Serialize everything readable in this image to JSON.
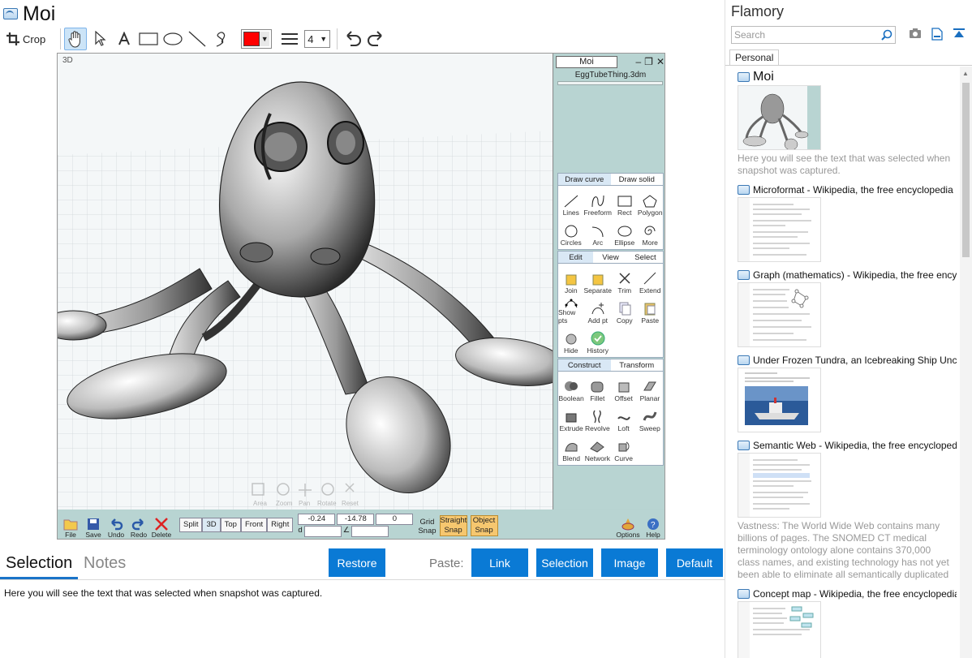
{
  "app": {
    "title": "Moi"
  },
  "toolbar": {
    "crop_label": "Crop",
    "line_width": "4",
    "color": "#ff0000"
  },
  "viewport": {
    "label": "3D",
    "nav_labels": [
      "Area",
      "Zoom",
      "Pan",
      "Rotate",
      "Reset"
    ]
  },
  "moi": {
    "panel_title": "Moi",
    "file_name": "EggTubeThing.3dm",
    "group1": {
      "tabs": [
        "Draw curve",
        "Draw solid"
      ],
      "items": [
        "Lines",
        "Freeform",
        "Rect",
        "Polygon",
        "Circles",
        "Arc",
        "Ellipse",
        "More"
      ]
    },
    "group2": {
      "tabs": [
        "Edit",
        "View",
        "Select"
      ],
      "items": [
        "Join",
        "Separate",
        "Trim",
        "Extend",
        "Show pts",
        "Add pt",
        "Copy",
        "Paste",
        "Hide",
        "History"
      ]
    },
    "group3": {
      "tabs": [
        "Construct",
        "Transform"
      ],
      "items": [
        "Boolean",
        "Fillet",
        "Offset",
        "Planar",
        "Extrude",
        "Revolve",
        "Loft",
        "Sweep",
        "Blend",
        "Network",
        "Curve"
      ]
    },
    "bottom": {
      "file": "File",
      "save": "Save",
      "undo": "Undo",
      "redo": "Redo",
      "delete": "Delete",
      "views": [
        "Split",
        "3D",
        "Top",
        "Front",
        "Right"
      ],
      "x": "-0.24",
      "y": "-14.78",
      "z": "0",
      "d_label": "d",
      "grid_snap": [
        "Grid",
        "Snap"
      ],
      "straight_snap": [
        "Straight",
        "Snap"
      ],
      "object_snap": [
        "Object",
        "Snap"
      ],
      "options": "Options",
      "help": "Help"
    }
  },
  "tabs": {
    "selection": "Selection",
    "notes": "Notes"
  },
  "buttons": {
    "restore": "Restore",
    "paste_label": "Paste:",
    "link": "Link",
    "selection": "Selection",
    "image": "Image",
    "default": "Default"
  },
  "selection_text": "Here you will see the text that was selected when snapshot was captured.",
  "sidebar": {
    "title": "Flamory",
    "search_placeholder": "Search",
    "tab": "Personal",
    "snapshots": [
      {
        "title": "Moi",
        "desc": "Here you will see the text that was selected when snapshot was captured."
      },
      {
        "title": "Microformat - Wikipedia, the free encyclopedia",
        "desc": ""
      },
      {
        "title": "Graph (mathematics) - Wikipedia, the free ency",
        "desc": ""
      },
      {
        "title": "Under Frozen Tundra, an Icebreaking Ship Unco",
        "desc": ""
      },
      {
        "title": "Semantic Web - Wikipedia, the free encycloped",
        "desc": "Vastness: The World Wide Web contains many billions of pages. The SNOMED CT medical terminology ontology alone contains 370,000 class names, and existing technology has not yet been able to eliminate all semantically duplicated terms. Any automated reasoning system will have to deal with truly huge inputs."
      },
      {
        "title": "Concept map - Wikipedia, the free encyclopedia",
        "desc": ""
      }
    ]
  }
}
